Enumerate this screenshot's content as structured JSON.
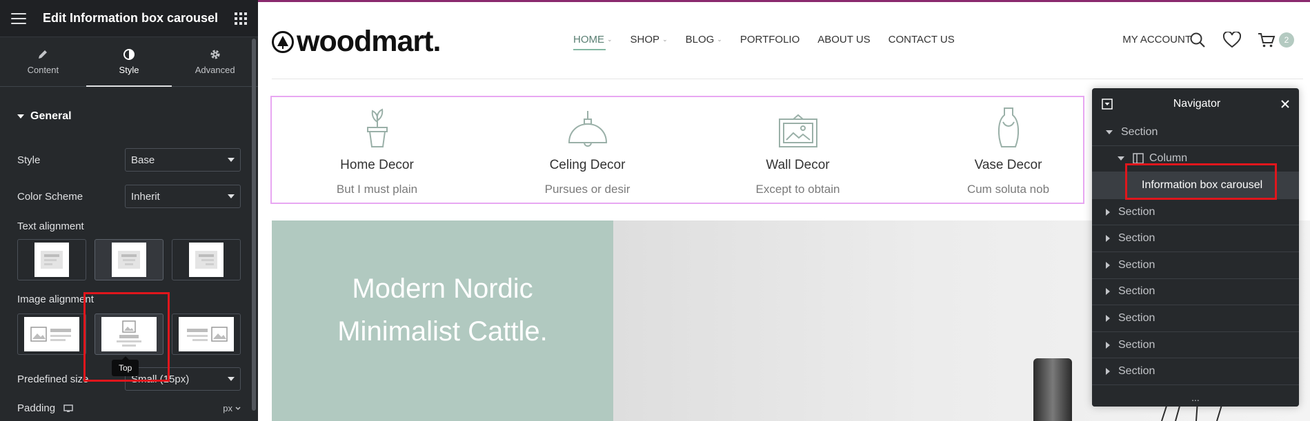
{
  "panel": {
    "title": "Edit Information box carousel",
    "tabs": [
      {
        "label": "Content",
        "icon": "pencil-icon"
      },
      {
        "label": "Style",
        "icon": "half-circle-icon"
      },
      {
        "label": "Advanced",
        "icon": "gear-icon"
      }
    ],
    "active_tab": "Style",
    "section": "General",
    "controls": {
      "style_label": "Style",
      "style_value": "Base",
      "color_scheme_label": "Color Scheme",
      "color_scheme_value": "Inherit",
      "text_alignment_label": "Text alignment",
      "image_alignment_label": "Image alignment",
      "predefined_size_label": "Predefined size",
      "predefined_size_value": "Small (15px)",
      "padding_label": "Padding",
      "padding_unit": "px"
    },
    "tooltip": "Top",
    "colors": {
      "panel_bg": "#26292c",
      "highlight": "#e0161c"
    }
  },
  "site": {
    "logo": "woodmart.",
    "nav": [
      {
        "label": "HOME",
        "dropdown": true
      },
      {
        "label": "SHOP",
        "dropdown": true
      },
      {
        "label": "BLOG",
        "dropdown": true
      },
      {
        "label": "PORTFOLIO",
        "dropdown": false
      },
      {
        "label": "ABOUT US",
        "dropdown": false
      },
      {
        "label": "CONTACT US",
        "dropdown": false
      }
    ],
    "account": "MY ACCOUNT",
    "cart_count": "2",
    "info_boxes": [
      {
        "title": "Home Decor",
        "subtitle": "But I must plain",
        "icon": "plant-pot-icon"
      },
      {
        "title": "Celing Decor",
        "subtitle": "Pursues or desir",
        "icon": "ceiling-lamp-icon"
      },
      {
        "title": "Wall Decor",
        "subtitle": "Except to obtain",
        "icon": "picture-frame-icon"
      },
      {
        "title": "Vase Decor",
        "subtitle": "Cum soluta nob",
        "icon": "vase-icon"
      }
    ],
    "hero_line1": "Modern Nordic",
    "hero_line2": "Minimalist Cattle.",
    "colors": {
      "accent": "#83b7a3",
      "hero_bg": "#b1c9c0",
      "carousel_outline": "#e8a7f2"
    }
  },
  "navigator": {
    "title": "Navigator",
    "rows": [
      {
        "label": "Section",
        "level": 0,
        "expanded": true
      },
      {
        "label": "Column",
        "level": 1,
        "expanded": true
      },
      {
        "label": "Information box carousel",
        "level": 2,
        "active": true
      },
      {
        "label": "Section",
        "level": 0,
        "expanded": false
      },
      {
        "label": "Section",
        "level": 0,
        "expanded": false
      },
      {
        "label": "Section",
        "level": 0,
        "expanded": false
      },
      {
        "label": "Section",
        "level": 0,
        "expanded": false
      },
      {
        "label": "Section",
        "level": 0,
        "expanded": false
      },
      {
        "label": "Section",
        "level": 0,
        "expanded": false
      },
      {
        "label": "Section",
        "level": 0,
        "expanded": false
      }
    ],
    "more": "..."
  }
}
